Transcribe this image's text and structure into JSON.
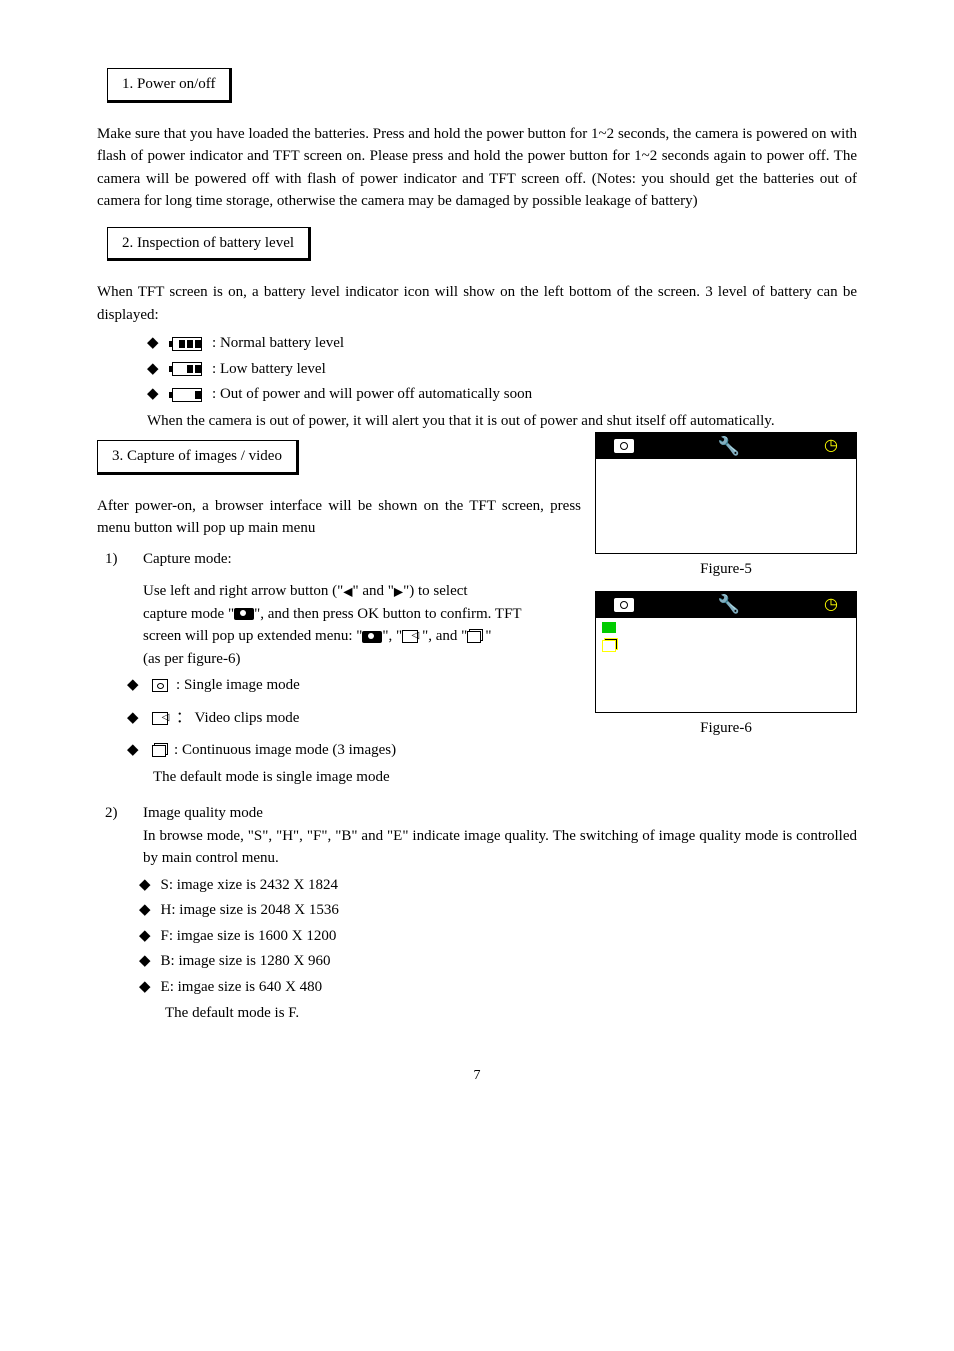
{
  "section1": {
    "title": "1. Power on/off"
  },
  "para1": "Make sure that you have loaded the batteries. Press and hold the power button for 1~2 seconds, the camera is powered on with flash of power indicator and TFT screen on. Please press and hold the power button for 1~2 seconds again to power off. The camera will be powered off with flash of power indicator and TFT screen off. (Notes: you should get the batteries out of camera for long time storage, otherwise the camera may be damaged by possible leakage of battery)",
  "section2": {
    "title": "2. Inspection of battery level"
  },
  "para2": "When TFT screen is on, a battery level indicator icon will show on the left bottom of the screen. 3 level of battery can be displayed:",
  "battery": {
    "normal": ": Normal battery level",
    "low": ": Low battery level",
    "out": ": Out of power and will power off automatically soon",
    "note": "When the camera is out of power, it will alert you that it is out of power and shut itself off automatically."
  },
  "section3": {
    "title": "3. Capture of images / video"
  },
  "para3": "After power-on, a browser interface will be shown on the TFT screen, press menu button will pop up main menu",
  "capture": {
    "num": "1)",
    "title": "Capture mode:",
    "line1a": "Use left and right arrow button (\"",
    "line1b": "\" and \"",
    "line1c": "\") to select",
    "line2a": "capture mode \"",
    "line2b": "\", and then press OK button to confirm. TFT",
    "line3a": "screen will pop up extended menu: \"",
    "line3b": "\", \"",
    "line3c": "\", and \"",
    "line3d": "\"",
    "line4": "(as per figure-6)",
    "single": " : Single image mode",
    "video": "： Video clips mode",
    "cont": ": Continuous image mode (3 images)",
    "default": "The default mode is single image mode"
  },
  "fig5": "Figure-5",
  "fig6": "Figure-6",
  "quality": {
    "num": "2)",
    "title": "Image quality mode",
    "desc": "In browse mode, \"S\", \"H\", \"F\", \"B\" and \"E\" indicate image quality. The switching of image quality mode is controlled by main control menu.",
    "s": "S: image xize is 2432 X 1824",
    "h": "H: image size is 2048 X 1536",
    "f": "F: imgae size is 1600 X 1200",
    "b": "B: image size is 1280 X 960",
    "e": "E: imgae size is 640 X 480",
    "default": "The default mode is F."
  },
  "pagenum": "7"
}
